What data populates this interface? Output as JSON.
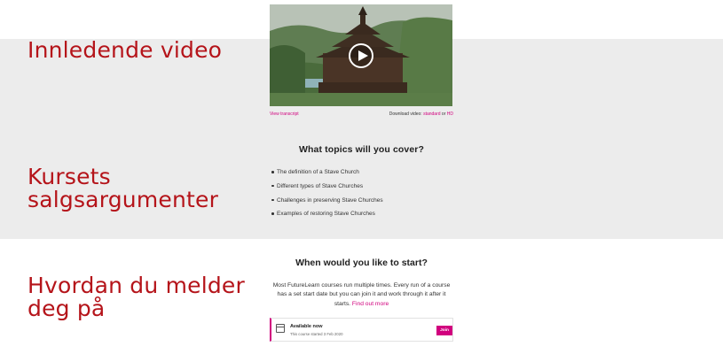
{
  "annotations": {
    "video_heading": "Innledende video",
    "selling_points_heading": "Kursets salgsargumenter",
    "enroll_heading": "Hvordan du melder deg på"
  },
  "video": {
    "transcript_link": "View transcript",
    "download_label": "Download video: ",
    "download_standard": "standard",
    "download_or": " or ",
    "download_hd": "HD"
  },
  "topics": {
    "title": "What topics will you cover?",
    "items": [
      "The definition of a Stave Church",
      "Different types of Stave Churches",
      "Challenges in preserving Stave Churches",
      "Examples of restoring Stave Churches"
    ]
  },
  "start": {
    "title": "When would you like to start?",
    "description": "Most FutureLearn courses run multiple times. Every run of a course has a set start date but you can join it and work through it after it starts. ",
    "find_out_more": "Find out more",
    "run": {
      "status": "Available now",
      "started": "This course started 3 Feb 2020",
      "join_label": "Join"
    }
  },
  "colors": {
    "annotation_red": "#b5141a",
    "accent_pink": "#d1007e",
    "band_gray": "#ececec"
  },
  "icons": [
    "play-icon",
    "calendar-icon"
  ]
}
